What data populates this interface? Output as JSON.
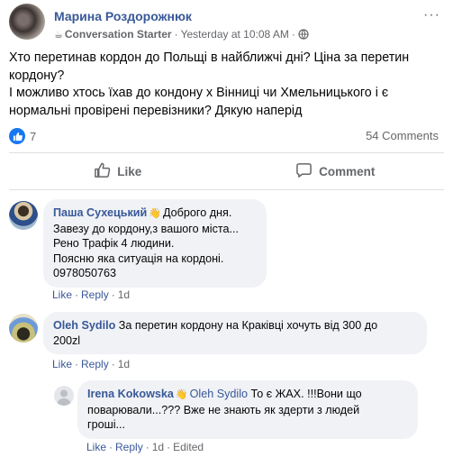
{
  "post": {
    "author": "Марина Роздорожнюк",
    "badge_icon": "coffee-cup-icon",
    "badge": "Conversation Starter",
    "time": "Yesterday at 10:08 AM",
    "visibility_icon": "globe-icon",
    "more": "···",
    "lines": [
      "Хто перетинав кордон до Польщі в найближчі дні? Ціна за перетин",
      "кордону?",
      "І можливо хтось їхав до кондону х Вінниці чи Хмельницького і є",
      "нормальні провірені перевізники? Дякую наперід"
    ],
    "reaction_count": "7",
    "comments_count": "54 Comments",
    "actions": {
      "like": "Like",
      "comment": "Comment"
    }
  },
  "comments": [
    {
      "author": "Паша Сухецький",
      "lines": [
        "Доброго дня.",
        "Завезу до кордону,з вашого міста...",
        "Рено Трафік 4 людини.",
        "Поясню яка ситуація на кордоні.",
        "0978050763"
      ],
      "like": "Like",
      "reply": "Reply",
      "age": "1d"
    },
    {
      "author": "Oleh Sydilo",
      "lines": [
        "За перетин кордону на Краківці хочуть від 300 до",
        "200zl"
      ],
      "like": "Like",
      "reply": "Reply",
      "age": "1d"
    },
    {
      "author": "Irena Kokowska",
      "mention": "Oleh Sydilo",
      "lines": [
        "То є ЖАХ. !!!Вони що",
        "поварювали...??? Вже не знають як здерти з людей",
        "гроші..."
      ],
      "like": "Like",
      "reply": "Reply",
      "age": "1d",
      "edited": "Edited"
    }
  ],
  "colors": {
    "link": "#385898",
    "meta": "#65676b",
    "bubble": "#f0f2f5",
    "like_blue": "#1877f2"
  }
}
